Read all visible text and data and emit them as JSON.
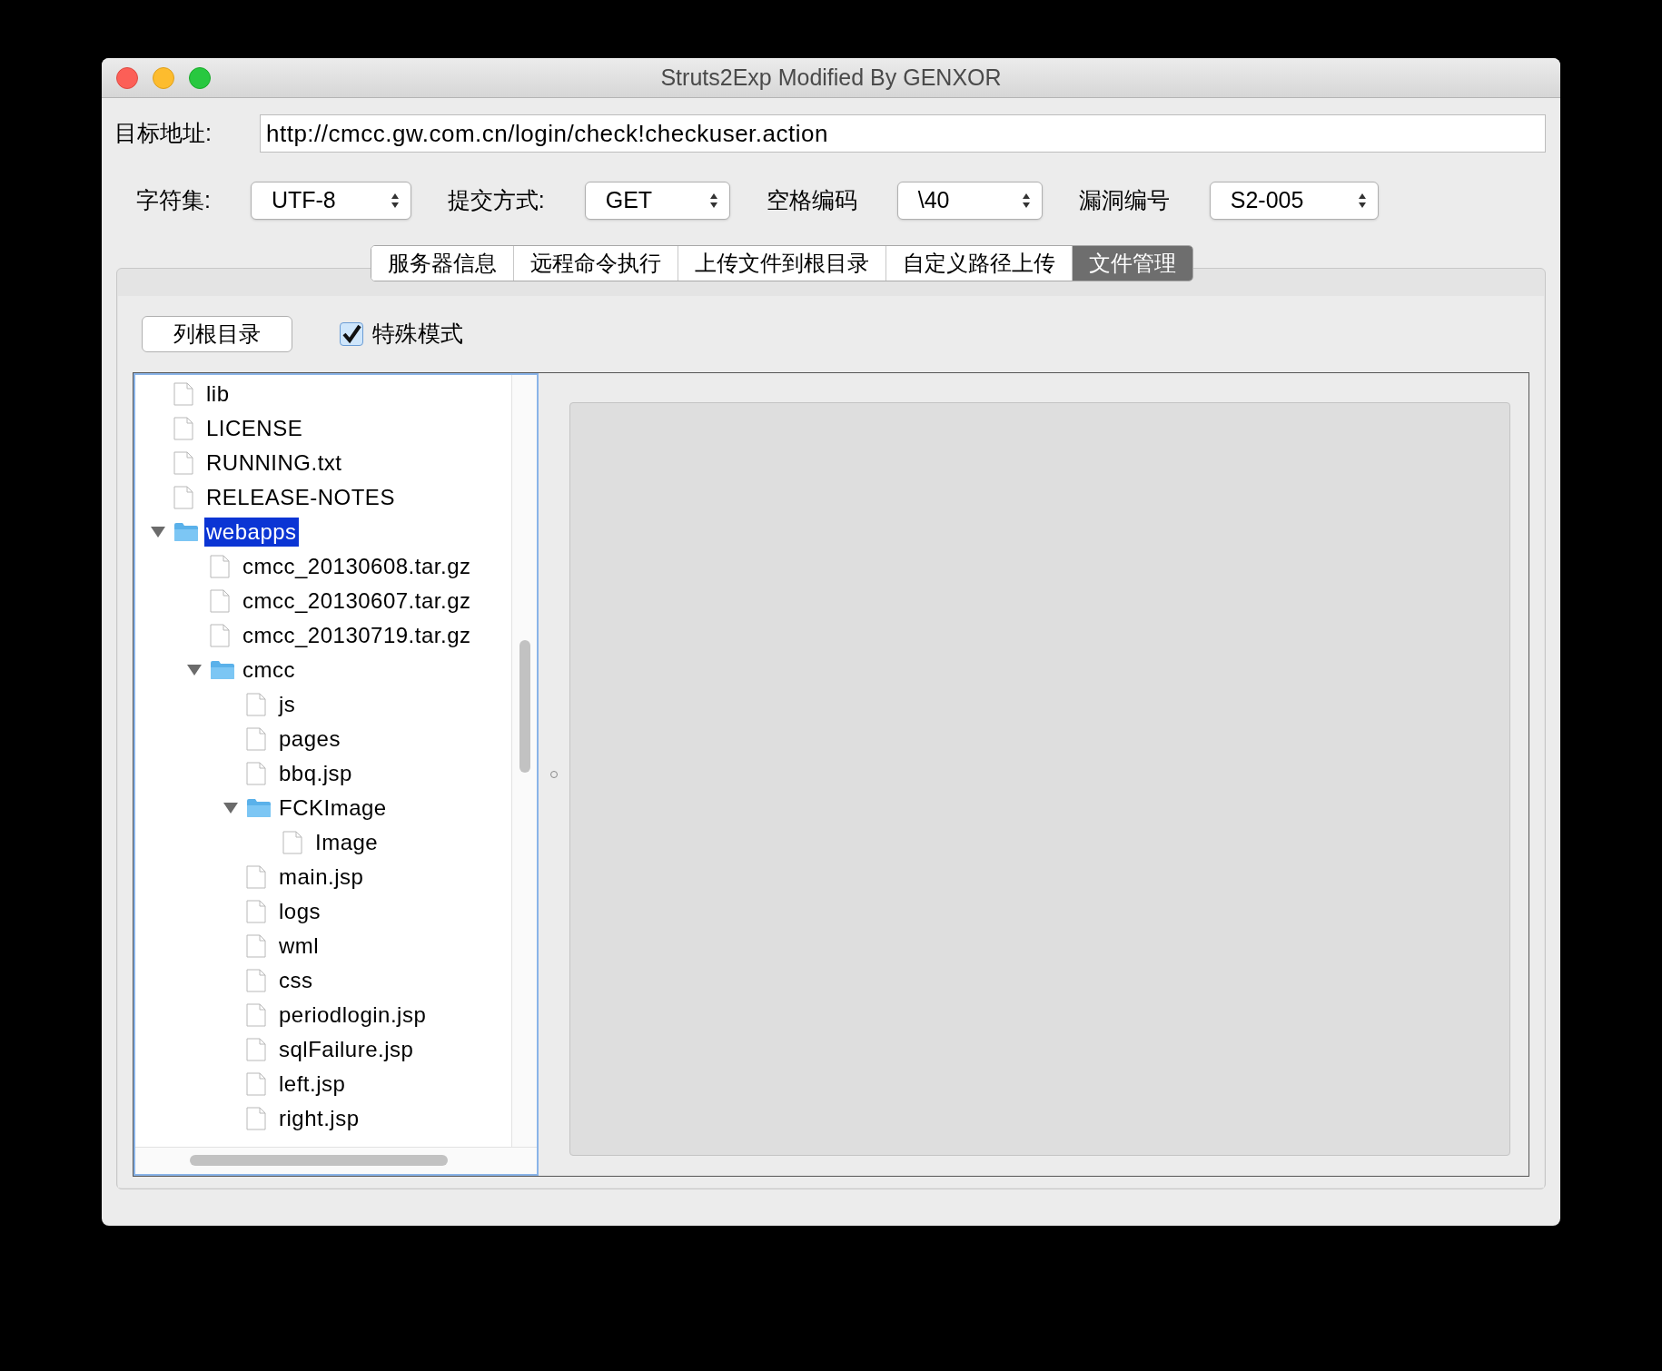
{
  "window": {
    "title": "Struts2Exp Modified By GENXOR"
  },
  "target": {
    "label": "目标地址:",
    "value": "http://cmcc.gw.com.cn/login/check!checkuser.action"
  },
  "options": [
    {
      "label": "字符集:",
      "value": "UTF-8"
    },
    {
      "label": "提交方式:",
      "value": "GET"
    },
    {
      "label": "空格编码",
      "value": "\\40"
    },
    {
      "label": "漏洞编号",
      "value": "S2-005"
    }
  ],
  "tabs": [
    {
      "label": "服务器信息",
      "selected": false
    },
    {
      "label": "远程命令执行",
      "selected": false
    },
    {
      "label": "上传文件到根目录",
      "selected": false
    },
    {
      "label": "自定义路径上传",
      "selected": false
    },
    {
      "label": "文件管理",
      "selected": true
    }
  ],
  "list_root_button": "列根目录",
  "special_mode": {
    "label": "特殊模式",
    "checked": true
  },
  "tree": [
    {
      "kind": "file",
      "name": "lib",
      "selected": false
    },
    {
      "kind": "file",
      "name": "LICENSE",
      "selected": false
    },
    {
      "kind": "file",
      "name": "RUNNING.txt",
      "selected": false
    },
    {
      "kind": "file",
      "name": "RELEASE-NOTES",
      "selected": false
    },
    {
      "kind": "folder",
      "name": "webapps",
      "selected": true,
      "expanded": true,
      "children": [
        {
          "kind": "file",
          "name": "cmcc_20130608.tar.gz",
          "selected": false
        },
        {
          "kind": "file",
          "name": "cmcc_20130607.tar.gz",
          "selected": false
        },
        {
          "kind": "file",
          "name": "cmcc_20130719.tar.gz",
          "selected": false
        },
        {
          "kind": "folder",
          "name": "cmcc",
          "selected": false,
          "expanded": true,
          "children": [
            {
              "kind": "file",
              "name": "js",
              "selected": false
            },
            {
              "kind": "file",
              "name": "pages",
              "selected": false
            },
            {
              "kind": "file",
              "name": "bbq.jsp",
              "selected": false
            },
            {
              "kind": "folder",
              "name": "FCKImage",
              "selected": false,
              "expanded": true,
              "children": [
                {
                  "kind": "file",
                  "name": "Image",
                  "selected": false
                }
              ]
            },
            {
              "kind": "file",
              "name": "main.jsp",
              "selected": false
            },
            {
              "kind": "file",
              "name": "logs",
              "selected": false
            },
            {
              "kind": "file",
              "name": "wml",
              "selected": false
            },
            {
              "kind": "file",
              "name": "css",
              "selected": false
            },
            {
              "kind": "file",
              "name": "periodlogin.jsp",
              "selected": false
            },
            {
              "kind": "file",
              "name": "sqlFailure.jsp",
              "selected": false
            },
            {
              "kind": "file",
              "name": "left.jsp",
              "selected": false
            },
            {
              "kind": "file",
              "name": "right.jsp",
              "selected": false
            }
          ]
        }
      ]
    }
  ]
}
